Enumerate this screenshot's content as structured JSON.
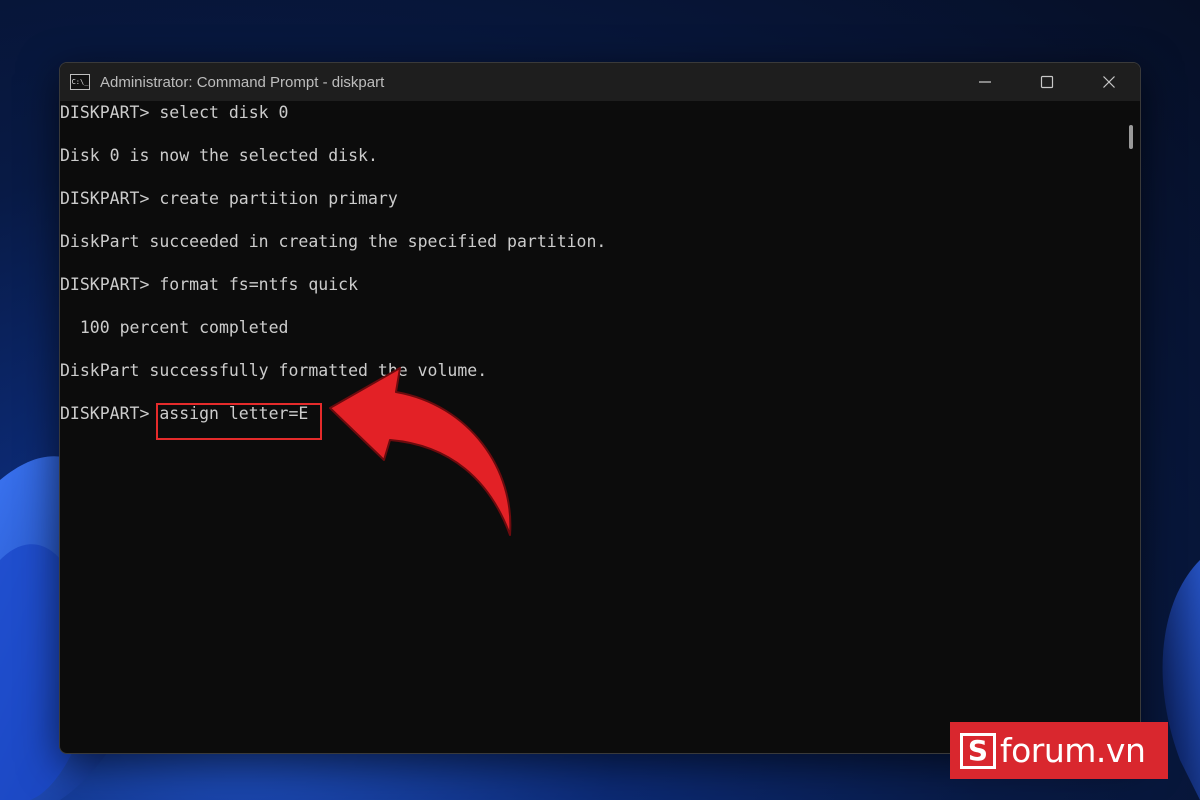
{
  "window": {
    "title": "Administrator: Command Prompt - diskpart",
    "icon": "cmd-icon",
    "icon_text": "C:\\_",
    "controls": [
      "minimize-icon",
      "maximize-icon",
      "close-icon"
    ]
  },
  "console": {
    "lines": [
      "DISKPART> select disk 0",
      "",
      "Disk 0 is now the selected disk.",
      "",
      "DISKPART> create partition primary",
      "",
      "DiskPart succeeded in creating the specified partition.",
      "",
      "DISKPART> format fs=ntfs quick",
      "",
      "  100 percent completed",
      "",
      "DiskPart successfully formatted the volume.",
      "",
      "DISKPART> assign letter=E"
    ],
    "prompt": "DISKPART> ",
    "highlighted_command": "assign letter=E"
  },
  "annotation": {
    "highlight_color": "#e52b2b",
    "arrow_color": "#e32126"
  },
  "watermark": {
    "logo_letter": "S",
    "text": "forum.vn",
    "background": "#d9272e"
  }
}
